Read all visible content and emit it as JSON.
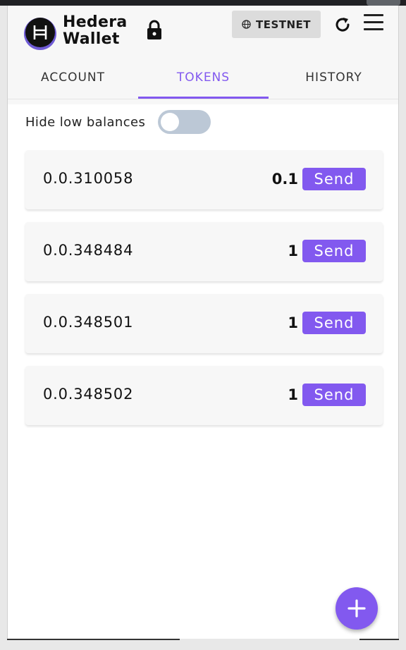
{
  "header": {
    "brand_line1": "Hedera",
    "brand_line2": "Wallet",
    "logo_icon": "hedera-logo-icon",
    "lock_icon": "lock-icon",
    "network_icon": "globe-icon",
    "network_label": "TESTNET",
    "refresh_icon": "refresh-icon",
    "menu_icon": "hamburger-menu-icon"
  },
  "tabs": [
    {
      "label": "ACCOUNT",
      "active": false
    },
    {
      "label": "TOKENS",
      "active": true
    },
    {
      "label": "HISTORY",
      "active": false
    }
  ],
  "filter": {
    "label": "Hide low balances",
    "enabled": false
  },
  "tokens": [
    {
      "id": "0.0.310058",
      "balance": "0.1",
      "action": "Send"
    },
    {
      "id": "0.0.348484",
      "balance": "1",
      "action": "Send"
    },
    {
      "id": "0.0.348501",
      "balance": "1",
      "action": "Send"
    },
    {
      "id": "0.0.348502",
      "balance": "1",
      "action": "Send"
    }
  ],
  "fab": {
    "icon": "plus-icon"
  },
  "colors": {
    "accent": "#8259ef",
    "header_bg": "#f7f7f7",
    "toggle_off": "#bcc8d6",
    "network_bg": "#dcdcdc"
  }
}
